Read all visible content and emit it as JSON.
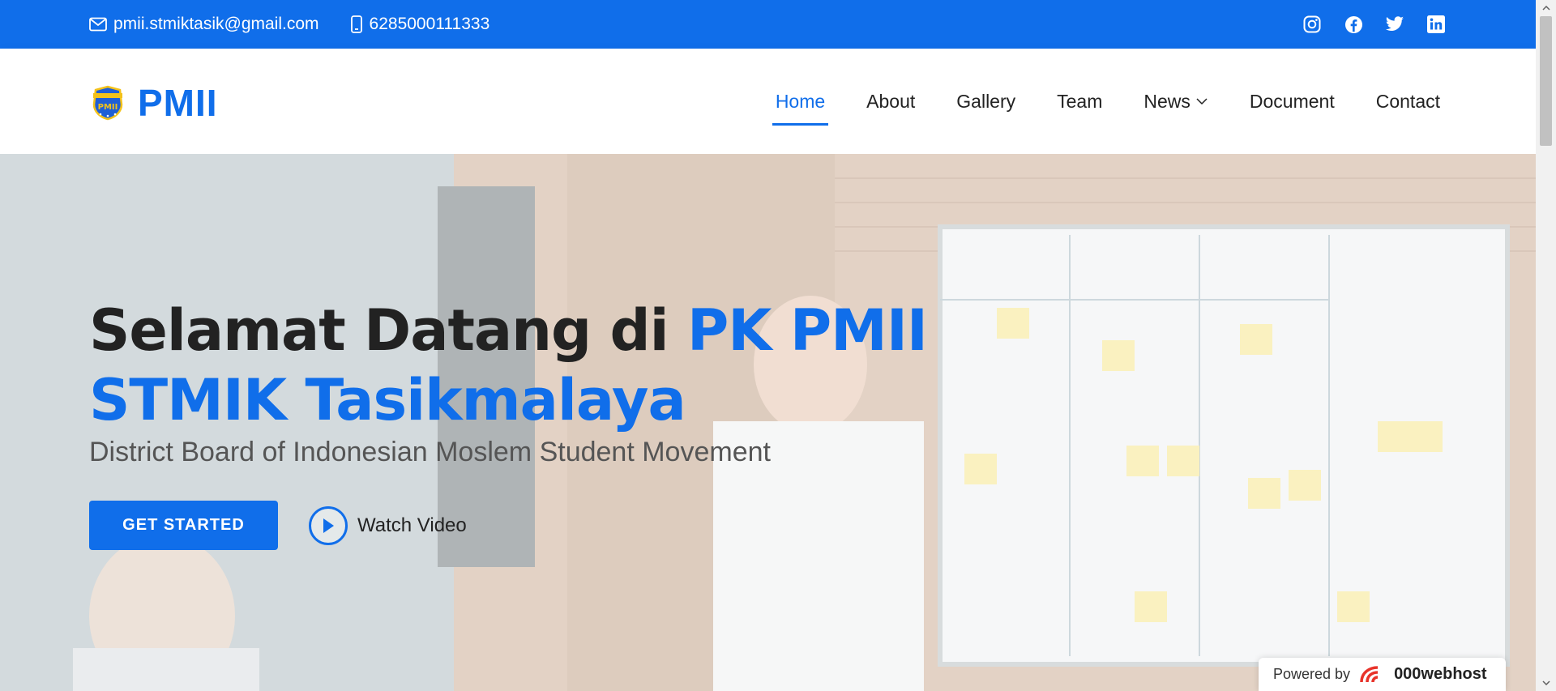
{
  "topbar": {
    "email": "pmii.stmiktasik@gmail.com",
    "phone": "6285000111333",
    "social": [
      {
        "icon": "instagram-icon"
      },
      {
        "icon": "facebook-icon"
      },
      {
        "icon": "twitter-icon"
      },
      {
        "icon": "linkedin-icon"
      }
    ]
  },
  "header": {
    "logo_text": "PMII",
    "logo_emblem_text": "PMII",
    "nav": [
      {
        "label": "Home",
        "active": true
      },
      {
        "label": "About"
      },
      {
        "label": "Gallery"
      },
      {
        "label": "Team"
      },
      {
        "label": "News",
        "dropdown": true
      },
      {
        "label": "Document"
      },
      {
        "label": "Contact"
      }
    ]
  },
  "hero": {
    "title_plain": "Selamat Datang di ",
    "title_accent": "PK PMII STMIK Tasikmalaya",
    "subtitle": "District Board of Indonesian Moslem Student Movement",
    "cta_label": "GET STARTED",
    "video_label": "Watch Video"
  },
  "footer_badge": {
    "powered_by": "Powered by",
    "brand": "000webhost"
  },
  "colors": {
    "accent": "#106eea",
    "text_dark": "#222222"
  }
}
